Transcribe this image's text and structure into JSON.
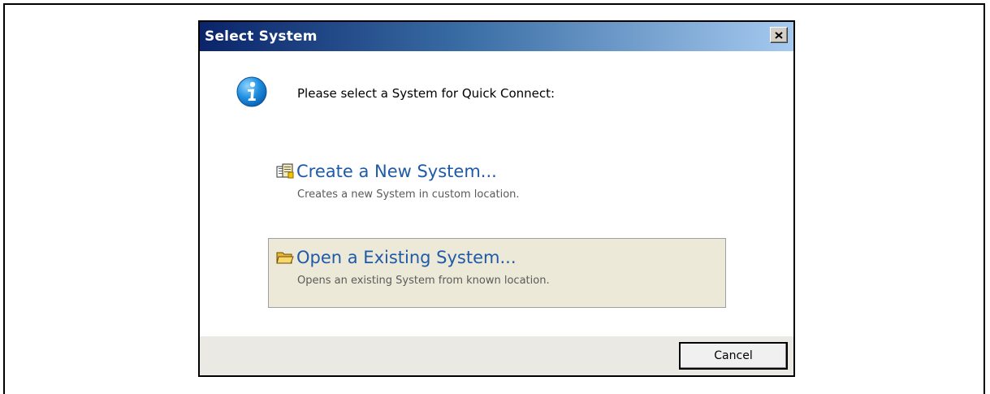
{
  "dialog": {
    "title": "Select System",
    "close_icon": "close-icon",
    "message": "Please select a System for Quick Connect:",
    "info_icon": "info-icon"
  },
  "options": [
    {
      "icon": "new-system-icon",
      "title": "Create a New System...",
      "description": "Creates a new System in custom location."
    },
    {
      "icon": "open-folder-icon",
      "title": "Open a Existing System...",
      "description": "Opens an existing System from known location."
    }
  ],
  "footer": {
    "cancel_label": "Cancel"
  },
  "colors": {
    "title_gradient_start": "#0a246a",
    "title_gradient_end": "#a6caf0",
    "link_blue": "#1e5aa8",
    "hover_background": "#ece9d8"
  }
}
